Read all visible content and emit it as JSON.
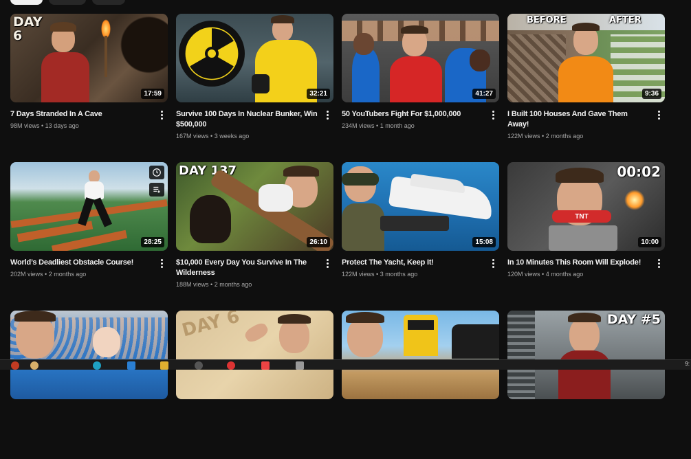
{
  "videos": [
    {
      "title": "7 Days Stranded In A Cave",
      "views": "98M views",
      "age": "13 days ago",
      "duration": "17:59",
      "overlay": "DAY 6"
    },
    {
      "title": "Survive 100 Days In Nuclear Bunker, Win $500,000",
      "views": "167M views",
      "age": "3 weeks ago",
      "duration": "32:21"
    },
    {
      "title": "50 YouTubers Fight For $1,000,000",
      "views": "234M views",
      "age": "1 month ago",
      "duration": "41:27"
    },
    {
      "title": "I Built 100 Houses And Gave Them Away!",
      "views": "122M views",
      "age": "2 months ago",
      "duration": "9:36",
      "overlay_left": "BEFORE",
      "overlay_right": "AFTER"
    },
    {
      "title": "World’s Deadliest Obstacle Course!",
      "views": "202M views",
      "age": "2 months ago",
      "duration": "28:25"
    },
    {
      "title": "$10,000 Every Day You Survive In The Wilderness",
      "views": "188M views",
      "age": "2 months ago",
      "duration": "26:10",
      "overlay": "DAY 137"
    },
    {
      "title": "Protect The Yacht, Keep It!",
      "views": "122M views",
      "age": "3 months ago",
      "duration": "15:08"
    },
    {
      "title": "In 10 Minutes This Room Will Explode!",
      "views": "120M views",
      "age": "4 months ago",
      "duration": "10:00",
      "overlay": "00:02",
      "overlay_sign": "TNT"
    },
    {
      "title": "",
      "views": "",
      "age": "",
      "duration": ""
    },
    {
      "title": "",
      "views": "",
      "age": "",
      "duration": "",
      "overlay": "DAY 6"
    },
    {
      "title": "",
      "views": "",
      "age": "",
      "duration": ""
    },
    {
      "title": "",
      "views": "",
      "age": "",
      "duration": "",
      "overlay": "DAY #5"
    }
  ],
  "sep": " • ",
  "taskbar": {
    "time": "9:"
  }
}
